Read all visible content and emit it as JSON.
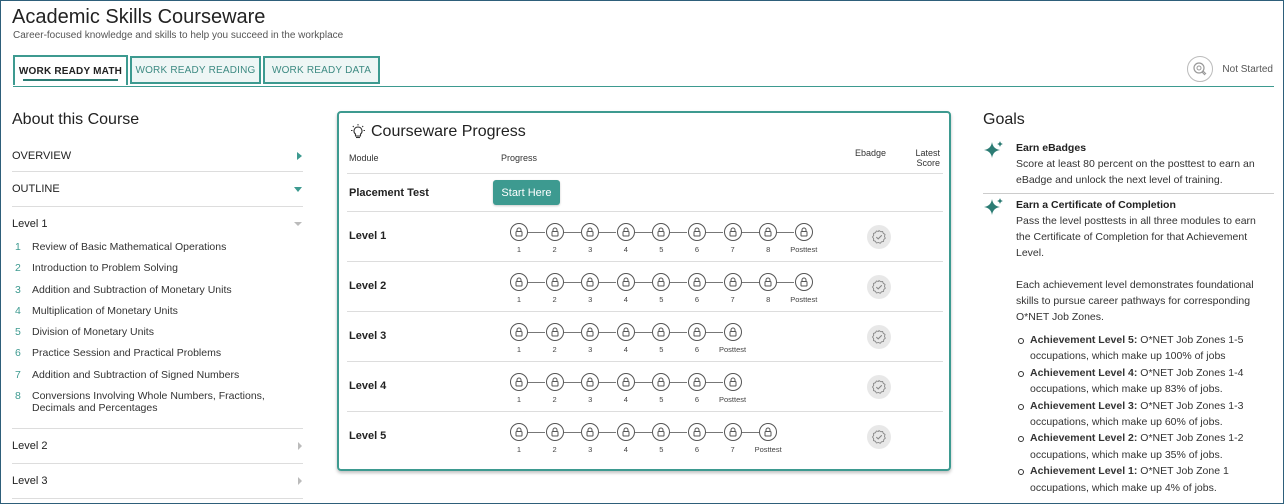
{
  "header": {
    "title": "Academic Skills Courseware",
    "subtitle": "Career-focused knowledge and skills to help you succeed in the workplace",
    "status": "Not Started"
  },
  "tabs": [
    {
      "label": "WORK READY MATH",
      "active": true
    },
    {
      "label": "WORK READY READING",
      "active": false
    },
    {
      "label": "WORK READY DATA",
      "active": false
    }
  ],
  "about": {
    "title": "About this Course",
    "overview": "OVERVIEW",
    "outline": "OUTLINE",
    "level1": "Level 1",
    "lessons": [
      {
        "num": "1",
        "label": "Review of Basic Mathematical Operations"
      },
      {
        "num": "2",
        "label": "Introduction to Problem Solving"
      },
      {
        "num": "3",
        "label": "Addition and Subtraction of Monetary Units"
      },
      {
        "num": "4",
        "label": "Multiplication of Monetary Units"
      },
      {
        "num": "5",
        "label": "Division of Monetary Units"
      },
      {
        "num": "6",
        "label": "Practice Session and Practical Problems"
      },
      {
        "num": "7",
        "label": "Addition and Subtraction of Signed Numbers"
      },
      {
        "num": "8",
        "label": "Conversions Involving Whole Numbers, Fractions, Decimals and Percentages"
      }
    ],
    "level2": "Level 2",
    "level3": "Level 3"
  },
  "progress": {
    "title": "Courseware Progress",
    "col_module": "Module",
    "col_progress": "Progress",
    "col_ebadge": "Ebadge",
    "col_latest_score_1": "Latest",
    "col_latest_score_2": "Score",
    "placement_label": "Placement Test",
    "start_button": "Start Here",
    "levels": [
      {
        "label": "Level 1",
        "steps": [
          "1",
          "2",
          "3",
          "4",
          "5",
          "6",
          "7",
          "8",
          "Posttest"
        ]
      },
      {
        "label": "Level 2",
        "steps": [
          "1",
          "2",
          "3",
          "4",
          "5",
          "6",
          "7",
          "8",
          "Posttest"
        ]
      },
      {
        "label": "Level 3",
        "steps": [
          "1",
          "2",
          "3",
          "4",
          "5",
          "6",
          "Posttest"
        ]
      },
      {
        "label": "Level 4",
        "steps": [
          "1",
          "2",
          "3",
          "4",
          "5",
          "6",
          "Posttest"
        ]
      },
      {
        "label": "Level 5",
        "steps": [
          "1",
          "2",
          "3",
          "4",
          "5",
          "6",
          "7",
          "Posttest"
        ]
      }
    ]
  },
  "goals": {
    "title": "Goals",
    "ebadges_title": "Earn eBadges",
    "ebadges_text": "Score at least 80 percent on the posttest to earn an eBadge and unlock the next level of training.",
    "cert_title": "Earn a Certificate of Completion",
    "cert_text": "Pass the level posttests in all three modules to earn the Certificate of Completion for that Achievement Level.",
    "cert_text2": "Each achievement level demonstrates foundational skills to pursue career pathways for corresponding O*NET Job Zones.",
    "achievements": [
      {
        "label": "Achievement Level 5:",
        "text": " O*NET Job Zones 1-5 occupations, which make up 100% of jobs"
      },
      {
        "label": "Achievement Level 4:",
        "text": " O*NET Job Zones 1-4 occupations, which make up 83% of jobs."
      },
      {
        "label": "Achievement Level 3:",
        "text": " O*NET Job Zones 1-3 occupations, which make up 60% of jobs."
      },
      {
        "label": "Achievement Level 2:",
        "text": " O*NET Job Zones 1-2 occupations, which make up 35% of jobs."
      },
      {
        "label": "Achievement Level 1:",
        "text": " O*NET Job Zone 1 occupations, which make up 4% of jobs."
      }
    ]
  },
  "colors": {
    "accent": "#3d9a90",
    "border": "#2e5f7a"
  }
}
